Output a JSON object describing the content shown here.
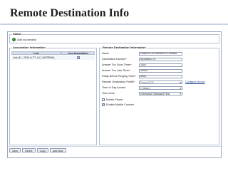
{
  "slide": {
    "title": "Remote Destination Info"
  },
  "status": {
    "legend": "Status",
    "icon": "info-icon",
    "message": "Add successful"
  },
  "association": {
    "legend": "Association Information",
    "columns": [
      "Line",
      "Line Association"
    ],
    "rows": [
      {
        "line": "Line [1] - 2030 in PT_UC_INTERNAL",
        "associated": true
      }
    ]
  },
  "remote_destination": {
    "legend": "Remote Destination Information",
    "fields": [
      {
        "label": "Name",
        "required": false,
        "value": "Pasad's Cell Number in Canada",
        "type": "text"
      },
      {
        "label": "Destination Number",
        "required": true,
        "value": "94146591717",
        "type": "text"
      },
      {
        "label": "Answer Too Soon Timer",
        "required": true,
        "value": "1500",
        "type": "text"
      },
      {
        "label": "Answer Too Late Timer",
        "required": true,
        "value": "19000",
        "type": "text"
      },
      {
        "label": "Delay Before Ringing Timer",
        "required": true,
        "value": "4000",
        "type": "text"
      },
      {
        "label": "Remote Destination Profile",
        "required": true,
        "value": "Pasad-RDP",
        "type": "select",
        "link": "Configure Device"
      },
      {
        "label": "Time of Day Access",
        "required": false,
        "value": "< None >",
        "type": "select"
      },
      {
        "label": "Time Zone",
        "required": false,
        "value": "Greenwich Standard Time",
        "type": "select"
      }
    ],
    "checkboxes": [
      {
        "label": "Mobile Phone",
        "checked": false
      },
      {
        "label": "Enable Mobile Connect",
        "checked": true
      }
    ]
  },
  "toolbar": {
    "buttons": [
      "Save",
      "Delete",
      "Copy",
      "Add New"
    ]
  }
}
